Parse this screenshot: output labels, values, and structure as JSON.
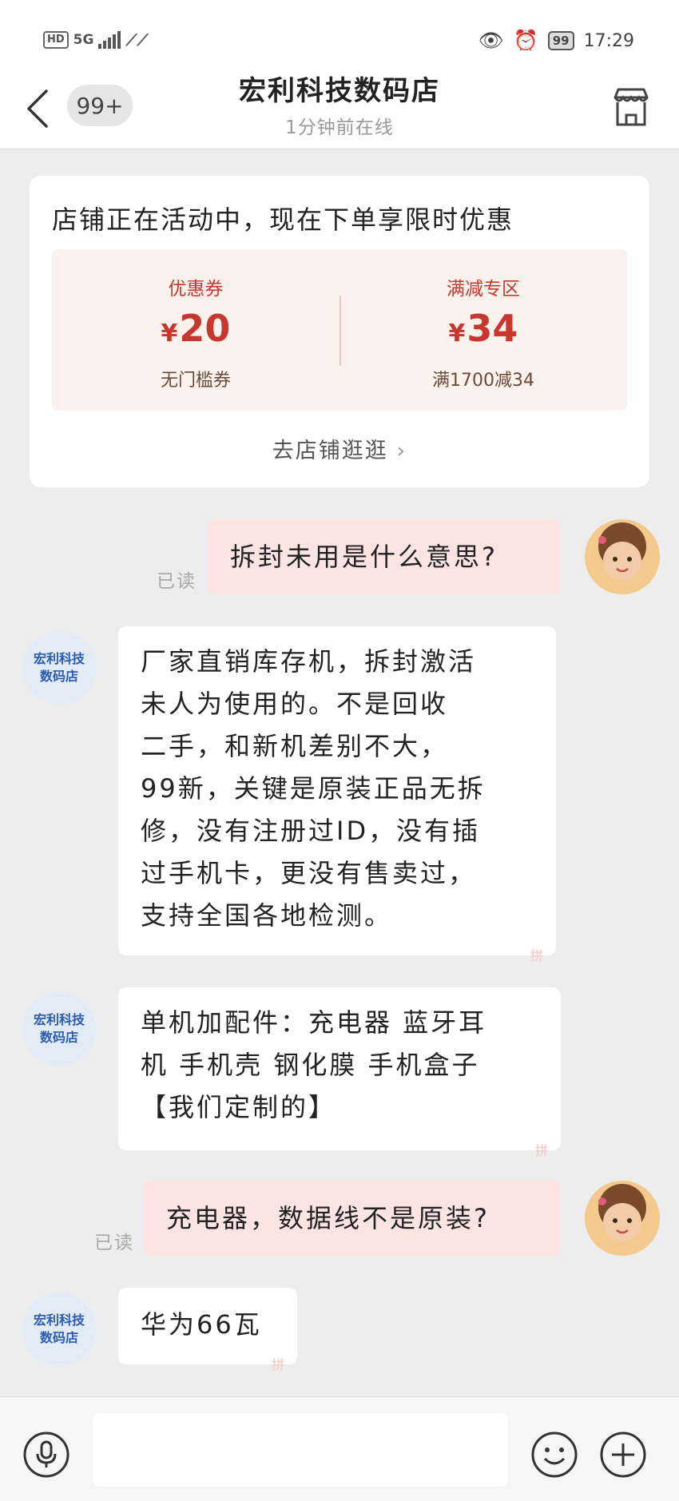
{
  "status": {
    "network": "5G",
    "battery": "99",
    "time": "17:29"
  },
  "header": {
    "badge": "99+",
    "title": "宏利科技数码店",
    "subtitle": "1分钟前在线"
  },
  "promo": {
    "title": "店铺正在活动中，现在下单享限时优惠",
    "coupons": [
      {
        "label": "优惠券",
        "currency": "¥",
        "amount": "20",
        "desc": "无门槛券"
      },
      {
        "label": "满减专区",
        "currency": "¥",
        "amount": "34",
        "desc": "满1700减34"
      }
    ],
    "link": "去店铺逛逛"
  },
  "shop": {
    "avatar_text_line1": "宏利科技",
    "avatar_text_line2": "数码店",
    "watermark": "拼"
  },
  "messages": [
    {
      "from": "me",
      "read": "已读",
      "text": "拆封未用是什么意思?"
    },
    {
      "from": "shop",
      "lines": [
        "厂家直销库存机，拆封激活",
        "未人为使用的。不是回收",
        "二手，和新机差别不大，",
        "99新，关键是原装正品无拆",
        "修，没有注册过ID，没有插",
        "过手机卡，更没有售卖过，",
        "支持全国各地检测。"
      ]
    },
    {
      "from": "shop",
      "lines": [
        "单机加配件：充电器 蓝牙耳",
        "机 手机壳 钢化膜  手机盒子",
        "【我们定制的】"
      ]
    },
    {
      "from": "me",
      "read": "已读",
      "text": "充电器，数据线不是原装?"
    },
    {
      "from": "shop",
      "lines": [
        "华为66瓦"
      ]
    }
  ],
  "input": {
    "value": ""
  },
  "colors": {
    "accent": "#c8372d",
    "me_bubble": "#fbe4e2",
    "background": "#ededed"
  }
}
